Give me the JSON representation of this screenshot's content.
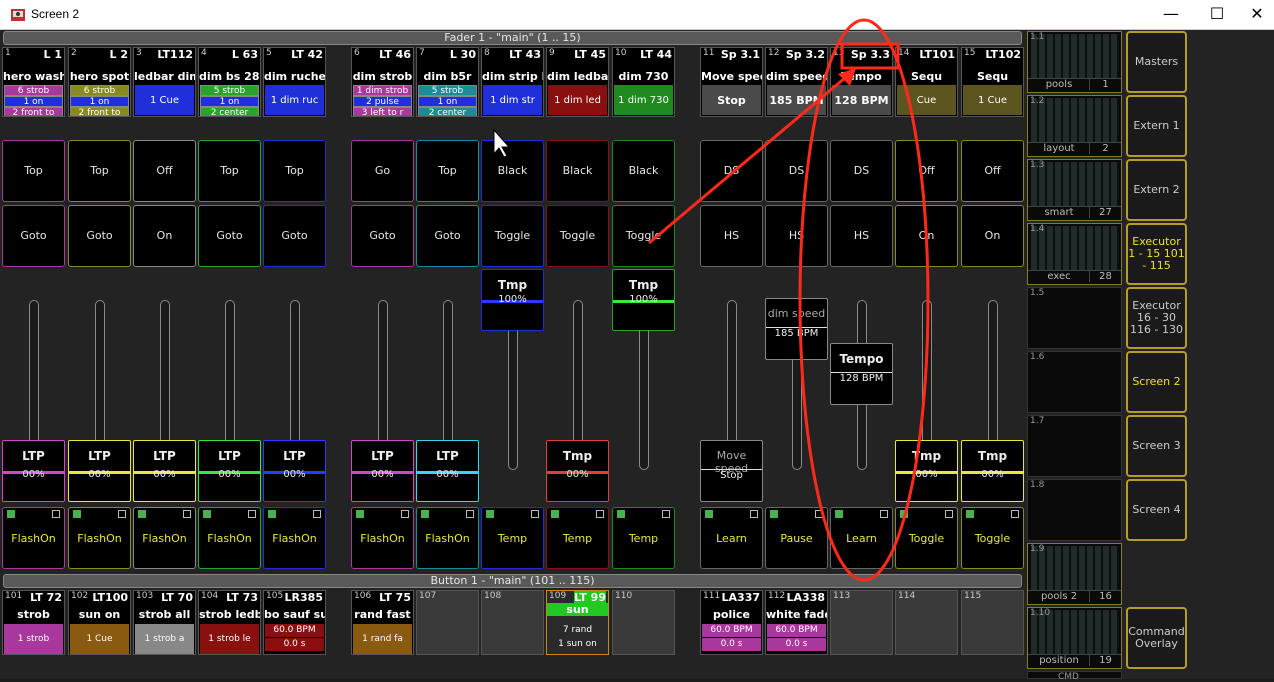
{
  "window": {
    "title": "Screen 2",
    "min": "—",
    "max": "☐",
    "close": "✕"
  },
  "sections": {
    "fader": "Fader  1  - \"main\" (1 .. 15)",
    "button": "Button  1  - \"main\" (101 .. 115)"
  },
  "headers": [
    {
      "num": "1",
      "type": "L",
      "id": "1",
      "title": "hero wash",
      "lines": [
        "6 strob",
        "1 on",
        "2 front to"
      ],
      "color": "#a9389c"
    },
    {
      "num": "2",
      "type": "L",
      "id": "2",
      "title": "hero spot",
      "lines": [
        "6 strob",
        "1 on",
        "2 front to"
      ],
      "color": "#888a20"
    },
    {
      "num": "3",
      "type": "LT112",
      "id": "",
      "title": "ledbar dim",
      "full": "1 Cue",
      "color": "#1f2fd9"
    },
    {
      "num": "4",
      "type": "L",
      "id": "63",
      "title": "dim bs 280",
      "lines": [
        "5 strob",
        "1 on",
        "2 center"
      ],
      "color": "#2aa32a"
    },
    {
      "num": "5",
      "type": "LT 42",
      "id": "",
      "title": "dim ruche",
      "full": "1 dim ruc",
      "color": "#1f2fd9"
    },
    {
      "num": "6",
      "type": "LT 46",
      "id": "",
      "title": "dim strob",
      "lines": [
        "1 dim strob",
        "2 pulse",
        "3 left to r"
      ],
      "color": "#a9389c"
    },
    {
      "num": "7",
      "type": "L",
      "id": "30",
      "title": "dim b5r",
      "lines": [
        "5 strob",
        "1 on",
        "2 center"
      ],
      "color": "#1a8c99"
    },
    {
      "num": "8",
      "type": "LT 43",
      "id": "",
      "title": "dim strip l",
      "full": "1 dim str",
      "color": "#1f2fd9"
    },
    {
      "num": "9",
      "type": "LT 45",
      "id": "",
      "title": "dim ledbar",
      "full": "1 dim led",
      "color": "#8a1010"
    },
    {
      "num": "10",
      "type": "LT 44",
      "id": "",
      "title": "dim 730",
      "full": "1 dim 730",
      "color": "#1f8a1f"
    },
    {
      "num": "11",
      "type": "Sp 3.1",
      "id": "",
      "title": "Move spee",
      "btn": "Stop",
      "color": "#444"
    },
    {
      "num": "12",
      "type": "Sp 3.2",
      "id": "",
      "title": "dim speed",
      "btn": "185 BPM",
      "color": "#444"
    },
    {
      "num": "13",
      "type": "Sp 3.3",
      "id": "",
      "title": "Tempo",
      "btn": "128 BPM",
      "color": "#444"
    },
    {
      "num": "14",
      "type": "LT101",
      "id": "",
      "title": "Sequ",
      "full": "Cue",
      "color": "#5c5520"
    },
    {
      "num": "15",
      "type": "LT102",
      "id": "",
      "title": "Sequ",
      "full": "1 Cue",
      "color": "#5c5520"
    }
  ],
  "top_buttons": [
    "Top",
    "Top",
    "Off",
    "Top",
    "Top",
    "Go",
    "Top",
    "Black",
    "Black",
    "Black",
    "DS",
    "DS",
    "DS",
    "Off",
    "Off"
  ],
  "mid_buttons": [
    "Goto",
    "Goto",
    "On",
    "Goto",
    "Goto",
    "Goto",
    "Goto",
    "Toggle",
    "Toggle",
    "Toggle",
    "HS",
    "HS",
    "HS",
    "On",
    "On"
  ],
  "mid_colors": [
    "#a9389c",
    "#888a20",
    "#888",
    "#2aa32a",
    "#1f2fd9",
    "#a9389c",
    "#1a8c99",
    "#1f2fd9",
    "#8a1010",
    "#1f8a1f",
    "#666",
    "#666",
    "#666",
    "#888a20",
    "#888a20"
  ],
  "tmp_knobs": {
    "label": "Tmp",
    "value": "100%"
  },
  "speed_knobs": {
    "dim": {
      "label": "dim speed",
      "value": "185 BPM"
    },
    "tempo": {
      "label": "Tempo",
      "value": "128 BPM"
    },
    "move": {
      "label": "Move speed",
      "value": "Stop"
    }
  },
  "bottom_knobs": [
    {
      "label": "LTP",
      "value": "00%",
      "color": "#d642c8"
    },
    {
      "label": "LTP",
      "value": "00%",
      "color": "#e8e83a"
    },
    {
      "label": "LTP",
      "value": "00%",
      "color": "#e8e83a"
    },
    {
      "label": "LTP",
      "value": "00%",
      "color": "#3ae83a"
    },
    {
      "label": "LTP",
      "value": "00%",
      "color": "#2b3aff"
    },
    {
      "label": "LTP",
      "value": "00%",
      "color": "#d642c8"
    },
    {
      "label": "LTP",
      "value": "00%",
      "color": "#35d8e8"
    },
    {
      "label": "Tmp",
      "value": "00%",
      "color": "#e83a3a"
    },
    {
      "label": "Tmp",
      "value": "00%",
      "color": "#e8e83a"
    },
    {
      "label": "Tmp",
      "value": "00%",
      "color": "#e8e83a"
    }
  ],
  "flash_buttons": [
    "FlashOn",
    "FlashOn",
    "FlashOn",
    "FlashOn",
    "FlashOn",
    "FlashOn",
    "FlashOn",
    "Temp",
    "Temp",
    "Temp",
    "Learn",
    "Pause",
    "Learn",
    "Toggle",
    "Toggle"
  ],
  "execs": [
    {
      "num": "101",
      "type": "LT 72",
      "title": "strob",
      "line": "1 strob",
      "color": "#a9389c"
    },
    {
      "num": "102",
      "type": "LT100",
      "title": "sun on",
      "line": "1 Cue",
      "color": "#8a5a10"
    },
    {
      "num": "103",
      "type": "LT 70",
      "title": "strob all",
      "line": "1 strob a",
      "color": "#888"
    },
    {
      "num": "104",
      "type": "LT 73",
      "title": "strob ledb",
      "line": "1 strob le",
      "color": "#8a1010"
    },
    {
      "num": "105",
      "type": "LR385",
      "title": "bo sauf su",
      "line": "60.0 BPM",
      "line2": "0.0 s",
      "color": "#8a1010"
    },
    {
      "num": "106",
      "type": "LT 75",
      "title": "rand fast",
      "line": "1 rand fa",
      "color": "#8a5a10"
    },
    {
      "num": "107",
      "type": "",
      "title": "",
      "line": "",
      "color": ""
    },
    {
      "num": "108",
      "type": "",
      "title": "",
      "line": "",
      "color": ""
    },
    {
      "num": "109",
      "type": "LT",
      "id": "99",
      "title": "sun",
      "line": "7 rand",
      "line2": "1 sun on",
      "color": "#2a2a2a"
    },
    {
      "num": "110",
      "type": "",
      "title": "",
      "line": "",
      "color": ""
    },
    {
      "num": "111",
      "type": "LA337",
      "title": "police",
      "line": "60.0 BPM",
      "line2": "0.0 s",
      "color": "#a9389c"
    },
    {
      "num": "112",
      "type": "LA338",
      "title": "white fade",
      "line": "60.0 BPM",
      "line2": "0.0 s",
      "color": "#a9389c"
    },
    {
      "num": "113",
      "type": "",
      "title": "",
      "line": "",
      "color": ""
    },
    {
      "num": "114",
      "type": "",
      "title": "",
      "line": "",
      "color": ""
    },
    {
      "num": "115",
      "type": "",
      "title": "",
      "line": "",
      "color": ""
    }
  ],
  "views": [
    {
      "num": "1.1",
      "name": "pools",
      "id": "1"
    },
    {
      "num": "1.2",
      "name": "layout",
      "id": "2"
    },
    {
      "num": "1.3",
      "name": "smart",
      "id": "27"
    },
    {
      "num": "1.4",
      "name": "exec",
      "id": "28"
    },
    {
      "num": "1.5",
      "name": "",
      "id": ""
    },
    {
      "num": "1.6",
      "name": "",
      "id": ""
    },
    {
      "num": "1.7",
      "name": "",
      "id": ""
    },
    {
      "num": "1.8",
      "name": "",
      "id": ""
    },
    {
      "num": "1.9",
      "name": "pools 2",
      "id": "16"
    },
    {
      "num": "1.10",
      "name": "position",
      "id": "19"
    }
  ],
  "view_last": "CMD",
  "right_buttons": [
    {
      "label": "Masters",
      "active": false
    },
    {
      "label": "Extern 1",
      "active": false
    },
    {
      "label": "Extern 2",
      "active": false
    },
    {
      "label": "Executor 1 - 15 101 - 115",
      "active": true
    },
    {
      "label": "Executor 16 - 30 116 - 130",
      "active": false
    },
    {
      "label": "Screen 2",
      "active": true
    },
    {
      "label": "Screen 3",
      "active": false
    },
    {
      "label": "Screen 4",
      "active": false
    },
    {
      "label": "",
      "active": false
    },
    {
      "label": "Command Overlay",
      "active": false
    }
  ]
}
